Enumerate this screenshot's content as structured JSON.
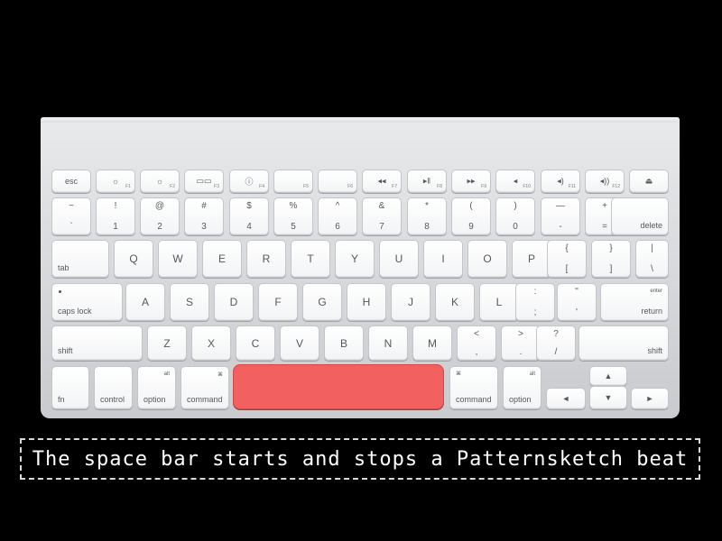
{
  "keyboard": {
    "function_row": [
      {
        "name": "esc-key",
        "label": "esc",
        "icon": "",
        "num": ""
      },
      {
        "name": "f1-key",
        "label": "",
        "icon": "☼",
        "num": "F1"
      },
      {
        "name": "f2-key",
        "label": "",
        "icon": "☼",
        "num": "F2"
      },
      {
        "name": "f3-key",
        "label": "",
        "icon": "▭▭",
        "num": "F3"
      },
      {
        "name": "f4-key",
        "label": "",
        "icon": "ⓘ",
        "num": "F4"
      },
      {
        "name": "f5-key",
        "label": "",
        "icon": "",
        "num": "F5"
      },
      {
        "name": "f6-key",
        "label": "",
        "icon": "",
        "num": "F6"
      },
      {
        "name": "f7-key",
        "label": "",
        "icon": "◂◂",
        "num": "F7"
      },
      {
        "name": "f8-key",
        "label": "",
        "icon": "▸ǁ",
        "num": "F8"
      },
      {
        "name": "f9-key",
        "label": "",
        "icon": "▸▸",
        "num": "F9"
      },
      {
        "name": "f10-key",
        "label": "",
        "icon": "◂",
        "num": "F10"
      },
      {
        "name": "f11-key",
        "label": "",
        "icon": "◂)",
        "num": "F11"
      },
      {
        "name": "f12-key",
        "label": "",
        "icon": "◂))",
        "num": "F12"
      },
      {
        "name": "eject-key",
        "label": "",
        "icon": "⏏",
        "num": ""
      }
    ],
    "number_row": [
      {
        "top": "~",
        "bottom": "`"
      },
      {
        "top": "!",
        "bottom": "1"
      },
      {
        "top": "@",
        "bottom": "2"
      },
      {
        "top": "#",
        "bottom": "3"
      },
      {
        "top": "$",
        "bottom": "4"
      },
      {
        "top": "%",
        "bottom": "5"
      },
      {
        "top": "^",
        "bottom": "6"
      },
      {
        "top": "&",
        "bottom": "7"
      },
      {
        "top": "*",
        "bottom": "8"
      },
      {
        "top": "(",
        "bottom": "9"
      },
      {
        "top": ")",
        "bottom": "0"
      },
      {
        "top": "—",
        "bottom": "-"
      },
      {
        "top": "+",
        "bottom": "="
      }
    ],
    "delete_label": "delete",
    "tab_label": "tab",
    "qwerty_row": [
      "Q",
      "W",
      "E",
      "R",
      "T",
      "Y",
      "U",
      "I",
      "O",
      "P"
    ],
    "bracket_keys": [
      {
        "top": "{",
        "bottom": "["
      },
      {
        "top": "}",
        "bottom": "]"
      },
      {
        "top": "|",
        "bottom": "\\"
      }
    ],
    "caps_label": "caps lock",
    "home_row": [
      "A",
      "S",
      "D",
      "F",
      "G",
      "H",
      "J",
      "K",
      "L"
    ],
    "semicolon_key": {
      "top": ":",
      "bottom": ";"
    },
    "quote_key": {
      "top": "\"",
      "bottom": "'"
    },
    "enter_label": "enter",
    "return_label": "return",
    "shift_left_label": "shift",
    "bottom_letters": [
      "Z",
      "X",
      "C",
      "V",
      "B",
      "N",
      "M"
    ],
    "punct_keys": [
      {
        "top": "<",
        "bottom": ","
      },
      {
        "top": ">",
        "bottom": "."
      },
      {
        "top": "?",
        "bottom": "/"
      }
    ],
    "shift_right_label": "shift",
    "fn_label": "fn",
    "control_label": "control",
    "alt_label": "alt",
    "option_label": "option",
    "command_label": "command",
    "command_symbol": "⌘",
    "arrows": {
      "up": "▲",
      "left": "◄",
      "down": "▼",
      "right": "►"
    },
    "highlight_color": "#f26060"
  },
  "caption": "The space bar starts and stops a Patternsketch beat"
}
